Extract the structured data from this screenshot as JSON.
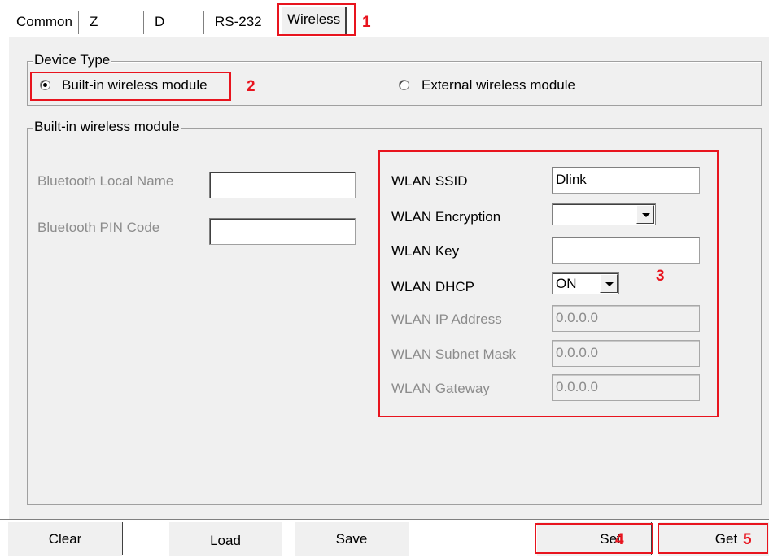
{
  "tabs": [
    {
      "label": "Common"
    },
    {
      "label": "Z"
    },
    {
      "label": "D"
    },
    {
      "label": "RS-232"
    },
    {
      "label": "Wireless"
    }
  ],
  "device_type": {
    "title": "Device Type",
    "builtin_label": "Built-in wireless module",
    "builtin_selected": true,
    "external_label": "External wireless module",
    "external_selected": false
  },
  "builtin": {
    "title": "Built-in wireless module",
    "bt_local_name_label": "Bluetooth Local Name",
    "bt_local_name_value": "",
    "bt_pin_label": "Bluetooth PIN Code",
    "bt_pin_value": ""
  },
  "wlan": {
    "ssid_label": "WLAN SSID",
    "ssid_value": "Dlink",
    "encryption_label": "WLAN Encryption",
    "encryption_value": "",
    "key_label": "WLAN Key",
    "key_value": "",
    "dhcp_label": "WLAN DHCP",
    "dhcp_value": "ON",
    "ip_label": "WLAN IP Address",
    "ip_value": "0.0.0.0",
    "mask_label": "WLAN Subnet Mask",
    "mask_value": "0.0.0.0",
    "gateway_label": "WLAN Gateway",
    "gateway_value": "0.0.0.0"
  },
  "buttons": {
    "clear": "Clear",
    "load": "Load",
    "save": "Save",
    "set": "Set",
    "get": "Get"
  },
  "annotations": {
    "n1": "1",
    "n2": "2",
    "n3": "3",
    "n4": "4",
    "n5": "5"
  },
  "colors": {
    "annotation_red": "#e8141e",
    "panel_bg": "#f0f0f0",
    "disabled_text": "#8c8c8c"
  }
}
